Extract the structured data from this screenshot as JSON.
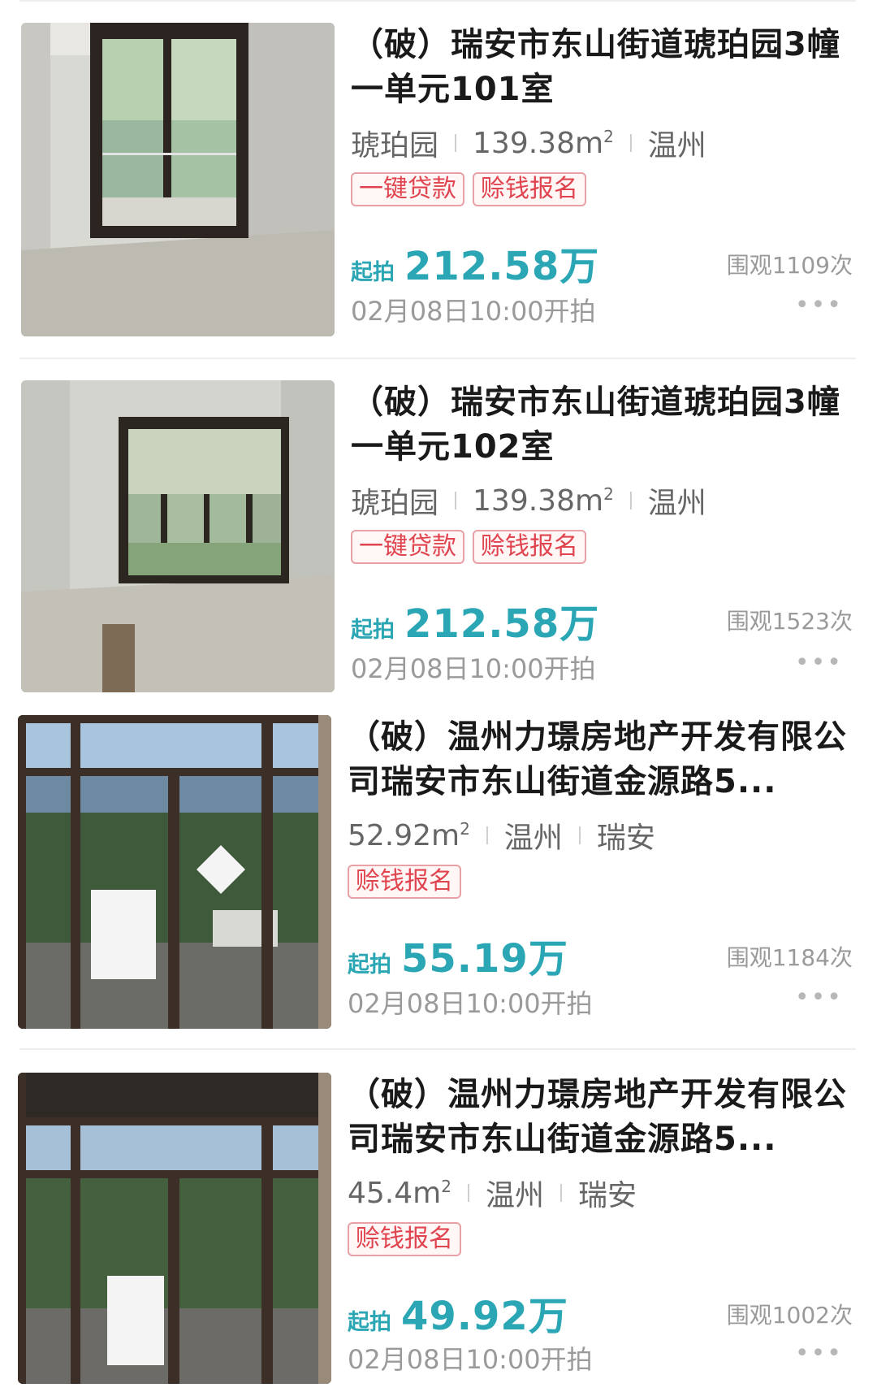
{
  "listings": [
    {
      "title": "（破）瑞安市东山街道琥珀园3幢一单元101室",
      "meta": [
        "琥珀园",
        "139.38m",
        "温州"
      ],
      "meta_sup": "2",
      "tags": [
        "一键贷款",
        "赊钱报名"
      ],
      "price_label": "起拍",
      "price": "212.58万",
      "views": "围观1109次",
      "auction_time": "02月08日10:00开拍",
      "more_icon": "ellipsis-icon"
    },
    {
      "title": "（破）瑞安市东山街道琥珀园3幢一单元102室",
      "meta": [
        "琥珀园",
        "139.38m",
        "温州"
      ],
      "meta_sup": "2",
      "tags": [
        "一键贷款",
        "赊钱报名"
      ],
      "price_label": "起拍",
      "price": "212.58万",
      "views": "围观1523次",
      "auction_time": "02月08日10:00开拍",
      "more_icon": "ellipsis-icon"
    },
    {
      "title": "（破）温州力璟房地产开发有限公司瑞安市东山街道金源路5...",
      "meta": [
        "52.92m",
        "温州",
        "瑞安"
      ],
      "meta_sup": "2",
      "tags": [
        "赊钱报名"
      ],
      "price_label": "起拍",
      "price": "55.19万",
      "views": "围观1184次",
      "auction_time": "02月08日10:00开拍",
      "more_icon": "ellipsis-icon"
    },
    {
      "title": "（破）温州力璟房地产开发有限公司瑞安市东山街道金源路5...",
      "meta": [
        "45.4m",
        "温州",
        "瑞安"
      ],
      "meta_sup": "2",
      "tags": [
        "赊钱报名"
      ],
      "price_label": "起拍",
      "price": "49.92万",
      "views": "围观1002次",
      "auction_time": "02月08日10:00开拍",
      "more_icon": "ellipsis-icon"
    }
  ],
  "colors": {
    "accent": "#2aa6b4",
    "tag_text": "#e0444f",
    "tag_border": "#e9a0a6",
    "muted": "#9a9a9a"
  }
}
